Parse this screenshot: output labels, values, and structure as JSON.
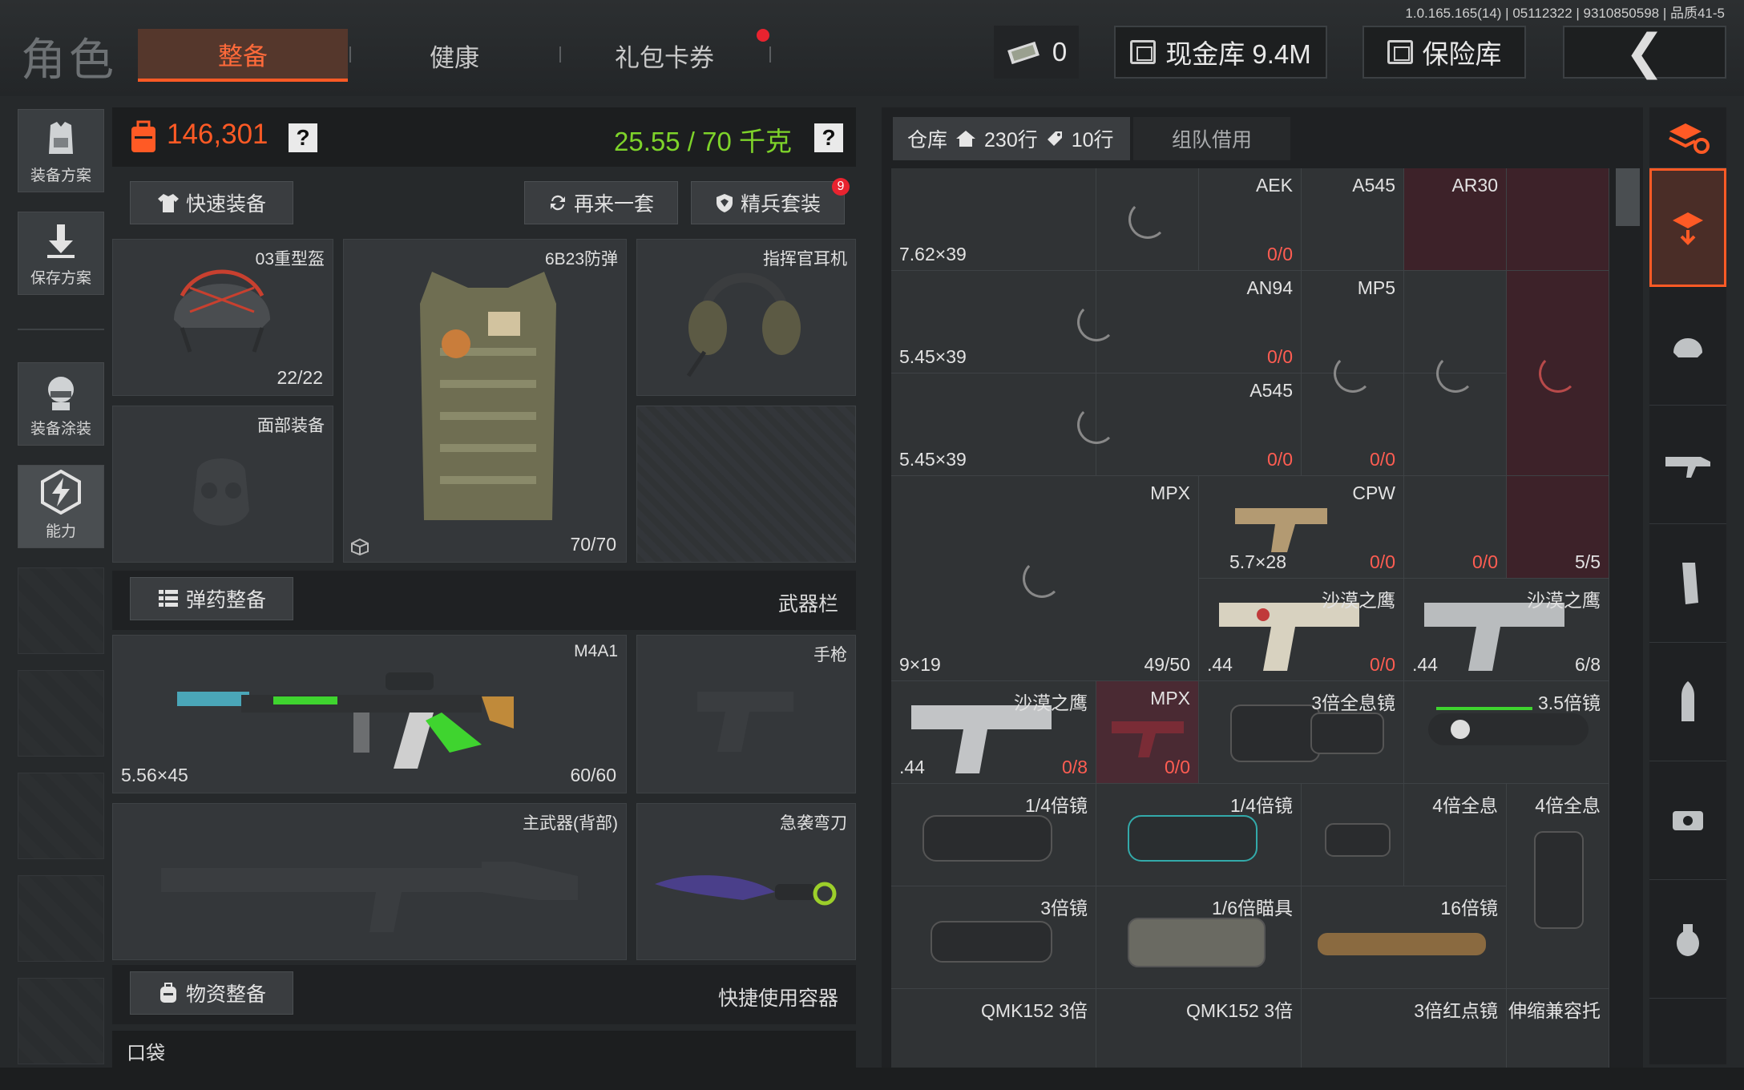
{
  "version": "1.0.165.165(14) | 05112322 | 9310850598 | 品质41-5",
  "header": {
    "title": "角色",
    "tabs": [
      {
        "label": "整备"
      },
      {
        "label": "健康"
      },
      {
        "label": "礼包卡券"
      }
    ],
    "cash_count": "0",
    "cash_vault_label": "现金库 9.4M",
    "safe_vault_label": "保险库",
    "back_glyph": "❮"
  },
  "sidebar": {
    "items": [
      {
        "label": "装备方案"
      },
      {
        "label": "保存方案"
      },
      {
        "label": "装备涂装"
      },
      {
        "label": "能力"
      }
    ]
  },
  "loadout": {
    "value": "146,301",
    "weight": "25.55 / 70 千克",
    "help_glyph": "?",
    "quick_equip_label": "快速装备",
    "again_label": "再来一套",
    "elite_label": "精兵套装",
    "elite_badge": "9",
    "helmet": {
      "label": "03重型盔",
      "durability": "22/22"
    },
    "armor": {
      "label": "6B23防弹",
      "durability": "70/70"
    },
    "headset": {
      "label": "指挥官耳机"
    },
    "face": {
      "label": "面部装备"
    },
    "ammo_section_label": "弹药整备",
    "weapon_bar_label": "武器栏",
    "primary": {
      "label": "M4A1",
      "caliber": "5.56×45",
      "ammo": "60/60"
    },
    "pistol": {
      "label": "手枪"
    },
    "back_weapon": {
      "label": "主武器(背部)"
    },
    "melee": {
      "label": "急袭弯刀"
    },
    "supply_section_label": "物资整备",
    "quick_container_label": "快捷使用容器",
    "pocket_label": "口袋"
  },
  "storage": {
    "tab_storage": "仓库",
    "rows_home": "230行",
    "rows_tag": "10行",
    "tab_team": "组队借用",
    "row1": {
      "cal": "7.62×39",
      "aek": "AEK",
      "a545": "A545",
      "ar30": "AR30",
      "aek_qty": "0/0"
    },
    "row2": {
      "cal": "5.45×39",
      "an94": "AN94",
      "mp5": "MP5",
      "an94_qty": "0/0"
    },
    "row3": {
      "cal": "5.45×39",
      "a545": "A545",
      "a545_qty": "0/0",
      "mp5_qty": "0/0"
    },
    "row4": {
      "mpx": "MPX",
      "cpw": "CPW",
      "cpw_cal": "5.7×28",
      "cpw_qty": "0/0",
      "c3_qty": "0/0",
      "c4_qty": "5/5"
    },
    "row5": {
      "cal": "9×19",
      "mpx_qty": "49/50",
      "de1": "沙漠之鹰",
      "de1_cal": ".44",
      "de1_qty": "0/0",
      "de2": "沙漠之鹰",
      "de2_cal": ".44",
      "de2_qty": "6/8"
    },
    "row6": {
      "de3": "沙漠之鹰",
      "de3_cal": ".44",
      "de3_qty": "0/8",
      "mpx": "MPX",
      "mpx_qty": "0/0",
      "holo3": "3倍全息镜",
      "scope35": "3.5倍镜"
    },
    "row7": {
      "s1": "1/4倍镜",
      "s2": "1/4倍镜",
      "s3": "4倍全息",
      "s4": "4倍全息"
    },
    "row8": {
      "s1": "3倍镜",
      "s2": "1/6倍瞄具",
      "s3": "16倍镜"
    },
    "row9": {
      "s1": "QMK152 3倍",
      "s2": "QMK152 3倍",
      "s3": "3倍红点镜",
      "s4": "伸缩兼容托"
    }
  }
}
